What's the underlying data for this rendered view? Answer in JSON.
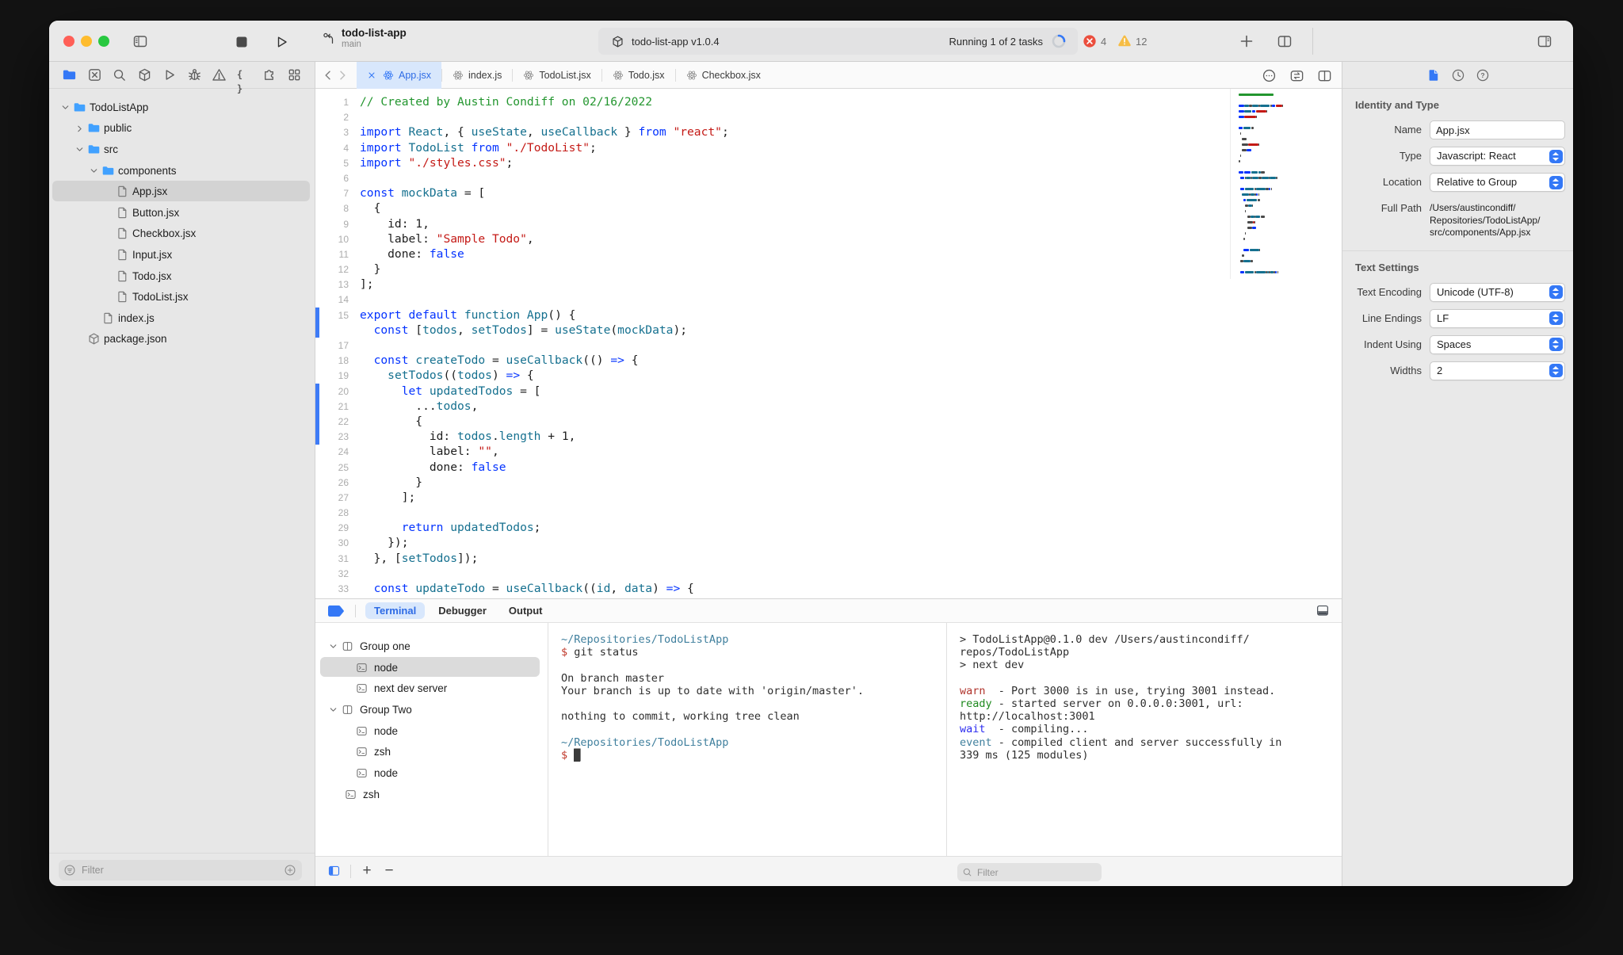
{
  "toolbar": {
    "project": "todo-list-app",
    "branch": "main",
    "status": {
      "package_label": "todo-list-app v1.0.4",
      "tasks_label": "Running 1 of 2 tasks",
      "error_count": "4",
      "warning_count": "12"
    },
    "icons": [
      "sidebar-toggle-icon",
      "stop-icon",
      "run-icon",
      "branch-icon",
      "package-icon",
      "spinner",
      "error-badge-icon",
      "warning-badge-icon",
      "add-icon",
      "split-editor-icon",
      "toggle-inspector-icon"
    ]
  },
  "navigator": {
    "rail_icons": [
      {
        "name": "project-navigator-icon",
        "glyph": "folder",
        "active": true
      },
      {
        "name": "source-control-navigator-icon",
        "glyph": "xsquare"
      },
      {
        "name": "search-navigator-icon",
        "glyph": "search"
      },
      {
        "name": "package-navigator-icon",
        "glyph": "cube"
      },
      {
        "name": "run-navigator-icon",
        "glyph": "play"
      },
      {
        "name": "bug-navigator-icon",
        "glyph": "bug"
      },
      {
        "name": "issues-navigator-icon",
        "glyph": "warn"
      },
      {
        "name": "symbols-navigator-icon",
        "glyph": "braces"
      },
      {
        "name": "extensions-navigator-icon",
        "glyph": "puzzle"
      },
      {
        "name": "overview-navigator-icon",
        "glyph": "grid"
      }
    ],
    "files": [
      {
        "label": "TodoListApp",
        "icon": "folder",
        "level": 0,
        "chevron": "down"
      },
      {
        "label": "public",
        "icon": "folder",
        "level": 1,
        "chevron": "right"
      },
      {
        "label": "src",
        "icon": "folder",
        "level": 1,
        "chevron": "down"
      },
      {
        "label": "components",
        "icon": "folder",
        "level": 2,
        "chevron": "down"
      },
      {
        "label": "App.jsx",
        "icon": "doc",
        "level": 3,
        "selected": true
      },
      {
        "label": "Button.jsx",
        "icon": "doc",
        "level": 3
      },
      {
        "label": "Checkbox.jsx",
        "icon": "doc",
        "level": 3
      },
      {
        "label": "Input.jsx",
        "icon": "doc",
        "level": 3
      },
      {
        "label": "Todo.jsx",
        "icon": "doc",
        "level": 3
      },
      {
        "label": "TodoList.jsx",
        "icon": "doc",
        "level": 3
      },
      {
        "label": "index.js",
        "icon": "doc",
        "level": 2
      },
      {
        "label": "package.json",
        "icon": "cube",
        "level": 1
      }
    ],
    "filter_placeholder": "Filter"
  },
  "editor": {
    "tabs": [
      {
        "label": "App.jsx",
        "active": true
      },
      {
        "label": "index.js"
      },
      {
        "label": "TodoList.jsx"
      },
      {
        "label": "Todo.jsx"
      },
      {
        "label": "Checkbox.jsx"
      }
    ],
    "change_bars": [
      {
        "from": 15,
        "to": 16
      },
      {
        "from": 20,
        "to": 23
      }
    ],
    "lines": [
      {
        "n": "1",
        "t": [
          [
            "// Created by Austin Condiff on 02/16/2022",
            "c"
          ]
        ]
      },
      {
        "n": "2",
        "t": []
      },
      {
        "n": "3",
        "t": [
          [
            "import ",
            "k"
          ],
          [
            "React",
            "i"
          ],
          [
            ", { ",
            "p"
          ],
          [
            "useState",
            "i"
          ],
          [
            ", ",
            "p"
          ],
          [
            "useCallback",
            "i"
          ],
          [
            " } ",
            "p"
          ],
          [
            "from",
            "k"
          ],
          [
            " ",
            "p"
          ],
          [
            "\"react\"",
            "s"
          ],
          [
            ";",
            "p"
          ]
        ]
      },
      {
        "n": "4",
        "t": [
          [
            "import ",
            "k"
          ],
          [
            "TodoList",
            "i"
          ],
          [
            " ",
            "p"
          ],
          [
            "from",
            "k"
          ],
          [
            " ",
            "p"
          ],
          [
            "\"./TodoList\"",
            "s"
          ],
          [
            ";",
            "p"
          ]
        ]
      },
      {
        "n": "5",
        "t": [
          [
            "import ",
            "k"
          ],
          [
            "\"./styles.css\"",
            "s"
          ],
          [
            ";",
            "p"
          ]
        ]
      },
      {
        "n": "6",
        "t": []
      },
      {
        "n": "7",
        "t": [
          [
            "const",
            "k"
          ],
          [
            " ",
            "p"
          ],
          [
            "mockData",
            "i"
          ],
          [
            " = [",
            "p"
          ]
        ]
      },
      {
        "n": "8",
        "t": [
          [
            "  {",
            "p"
          ]
        ]
      },
      {
        "n": "9",
        "t": [
          [
            "    id: 1,",
            "p"
          ]
        ]
      },
      {
        "n": "10",
        "t": [
          [
            "    label: ",
            "p"
          ],
          [
            "\"Sample Todo\"",
            "s"
          ],
          [
            ",",
            "p"
          ]
        ]
      },
      {
        "n": "11",
        "t": [
          [
            "    done: ",
            "p"
          ],
          [
            "false",
            "k"
          ]
        ]
      },
      {
        "n": "12",
        "t": [
          [
            "  }",
            "p"
          ]
        ]
      },
      {
        "n": "13",
        "t": [
          [
            "];",
            "p"
          ]
        ]
      },
      {
        "n": "14",
        "t": []
      },
      {
        "n": "15",
        "t": [
          [
            "export",
            "k"
          ],
          [
            " ",
            "p"
          ],
          [
            "default",
            "k"
          ],
          [
            " ",
            "p"
          ],
          [
            "function",
            "i"
          ],
          [
            " ",
            "p"
          ],
          [
            "App",
            "i"
          ],
          [
            "() {",
            "p"
          ]
        ]
      },
      {
        "n": "",
        "t": [
          [
            "  ",
            "p"
          ],
          [
            "const",
            "k"
          ],
          [
            " [",
            "p"
          ],
          [
            "todos",
            "i"
          ],
          [
            ", ",
            "p"
          ],
          [
            "setTodos",
            "i"
          ],
          [
            "] = ",
            "p"
          ],
          [
            "useState",
            "i"
          ],
          [
            "(",
            "p"
          ],
          [
            "mockData",
            "i"
          ],
          [
            ");",
            "p"
          ]
        ]
      },
      {
        "n": "17",
        "t": []
      },
      {
        "n": "18",
        "t": [
          [
            "  ",
            "p"
          ],
          [
            "const",
            "k"
          ],
          [
            " ",
            "p"
          ],
          [
            "createTodo",
            "i"
          ],
          [
            " = ",
            "p"
          ],
          [
            "useCallback",
            "i"
          ],
          [
            "(() ",
            "p"
          ],
          [
            "=>",
            "k"
          ],
          [
            " {",
            "p"
          ]
        ]
      },
      {
        "n": "19",
        "t": [
          [
            "    ",
            "p"
          ],
          [
            "setTodos",
            "i"
          ],
          [
            "((",
            "p"
          ],
          [
            "todos",
            "i"
          ],
          [
            ") ",
            "p"
          ],
          [
            "=>",
            "k"
          ],
          [
            " {",
            "p"
          ]
        ]
      },
      {
        "n": "20",
        "t": [
          [
            "      ",
            "p"
          ],
          [
            "let",
            "k"
          ],
          [
            " ",
            "p"
          ],
          [
            "updatedTodos",
            "i"
          ],
          [
            " = [",
            "p"
          ]
        ]
      },
      {
        "n": "21",
        "t": [
          [
            "        ...",
            "p"
          ],
          [
            "todos",
            "i"
          ],
          [
            ",",
            "p"
          ]
        ]
      },
      {
        "n": "22",
        "t": [
          [
            "        {",
            "p"
          ]
        ]
      },
      {
        "n": "23",
        "t": [
          [
            "          id: ",
            "p"
          ],
          [
            "todos",
            "i"
          ],
          [
            ".",
            "p"
          ],
          [
            "length",
            "i"
          ],
          [
            " + 1,",
            "p"
          ]
        ]
      },
      {
        "n": "24",
        "t": [
          [
            "          label: ",
            "p"
          ],
          [
            "\"\"",
            "s"
          ],
          [
            ",",
            "p"
          ]
        ]
      },
      {
        "n": "25",
        "t": [
          [
            "          done: ",
            "p"
          ],
          [
            "false",
            "k"
          ]
        ]
      },
      {
        "n": "26",
        "t": [
          [
            "        }",
            "p"
          ]
        ]
      },
      {
        "n": "27",
        "t": [
          [
            "      ];",
            "p"
          ]
        ]
      },
      {
        "n": "28",
        "t": []
      },
      {
        "n": "29",
        "t": [
          [
            "      ",
            "p"
          ],
          [
            "return",
            "k"
          ],
          [
            " ",
            "p"
          ],
          [
            "updatedTodos",
            "i"
          ],
          [
            ";",
            "p"
          ]
        ]
      },
      {
        "n": "30",
        "t": [
          [
            "    });",
            "p"
          ]
        ]
      },
      {
        "n": "31",
        "t": [
          [
            "  }, [",
            "p"
          ],
          [
            "setTodos",
            "i"
          ],
          [
            "]);",
            "p"
          ]
        ]
      },
      {
        "n": "32",
        "t": []
      },
      {
        "n": "33",
        "t": [
          [
            "  ",
            "p"
          ],
          [
            "const",
            "k"
          ],
          [
            " ",
            "p"
          ],
          [
            "updateTodo",
            "i"
          ],
          [
            " = ",
            "p"
          ],
          [
            "useCallback",
            "i"
          ],
          [
            "((",
            "p"
          ],
          [
            "id",
            "i"
          ],
          [
            ", ",
            "p"
          ],
          [
            "data",
            "i"
          ],
          [
            ") ",
            "p"
          ],
          [
            "=>",
            "k"
          ],
          [
            " {",
            "p"
          ]
        ]
      }
    ]
  },
  "inspector": {
    "sections": [
      {
        "title": "Identity and Type",
        "rows": [
          {
            "label": "Name",
            "type": "input",
            "value": "App.jsx"
          },
          {
            "label": "Type",
            "type": "select",
            "value": "Javascript: React"
          },
          {
            "label": "Location",
            "type": "select",
            "value": "Relative to Group"
          },
          {
            "label": "Full Path",
            "type": "text",
            "value": "/Users/austincondiff/\nRepositories/TodoListApp/\nsrc/components/App.jsx"
          }
        ]
      },
      {
        "title": "Text Settings",
        "rows": [
          {
            "label": "Text Encoding",
            "type": "select",
            "value": "Unicode (UTF-8)"
          },
          {
            "label": "Line Endings",
            "type": "select",
            "value": "LF"
          },
          {
            "label": "Indent Using",
            "type": "select",
            "value": "Spaces"
          },
          {
            "label": "Widths",
            "type": "select",
            "value": "2"
          }
        ]
      }
    ]
  },
  "terminal_panel": {
    "tabs": [
      {
        "label": "Terminal",
        "active": true
      },
      {
        "label": "Debugger"
      },
      {
        "label": "Output"
      }
    ],
    "sessions": [
      {
        "label": "Group one",
        "kind": "group",
        "level": 0,
        "chevron": true
      },
      {
        "label": "node",
        "kind": "shell",
        "level": 1,
        "selected": true
      },
      {
        "label": "next dev server",
        "kind": "shell",
        "level": 1
      },
      {
        "label": "Group Two",
        "kind": "group",
        "level": 0,
        "chevron": true
      },
      {
        "label": "node",
        "kind": "shell",
        "level": 1
      },
      {
        "label": "zsh",
        "kind": "shell",
        "level": 1
      },
      {
        "label": "node",
        "kind": "shell",
        "level": 1
      },
      {
        "label": "zsh",
        "kind": "shell",
        "level": 0
      }
    ],
    "shell_left": [
      [
        [
          "~/Repositories/TodoListApp",
          "path"
        ]
      ],
      [
        [
          "$",
          "prompt"
        ],
        [
          " git status",
          "plain"
        ]
      ],
      [],
      [
        [
          "On branch master",
          "plain"
        ]
      ],
      [
        [
          "Your branch is up to date with 'origin/master'.",
          "plain"
        ]
      ],
      [],
      [
        [
          "nothing to commit, working tree clean",
          "plain"
        ]
      ],
      [],
      [
        [
          "~/Repositories/TodoListApp",
          "path"
        ]
      ],
      [
        [
          "$ ",
          "prompt"
        ],
        [
          "█",
          "cursor"
        ]
      ]
    ],
    "shell_right": [
      [
        [
          "> TodoListApp@0.1.0 dev /Users/austincondiff/",
          "plain"
        ]
      ],
      [
        [
          "repos/TodoListApp",
          "plain"
        ]
      ],
      [
        [
          "> next dev",
          "plain"
        ]
      ],
      [],
      [
        [
          "warn",
          "warn"
        ],
        [
          "  - Port 3000 is in use, trying 3001 instead.",
          "plain"
        ]
      ],
      [
        [
          "ready",
          "ready"
        ],
        [
          " - started server on 0.0.0.0:3001, url:",
          "plain"
        ]
      ],
      [
        [
          "http://localhost:3001",
          "plain"
        ]
      ],
      [
        [
          "wait",
          "wait"
        ],
        [
          "  - compiling...",
          "plain"
        ]
      ],
      [
        [
          "event",
          "event"
        ],
        [
          " - compiled client and server successfully in",
          "plain"
        ]
      ],
      [
        [
          "339 ms (125 modules)",
          "plain"
        ]
      ]
    ],
    "filter_placeholder": "Filter"
  },
  "colors": {
    "accent": "#3478F6",
    "error": "#EB4E3D",
    "warning": "#F6BD45",
    "syntax_keyword": "#0433FF",
    "syntax_type": "#15708F",
    "syntax_string": "#C41A16",
    "syntax_comment": "#23962F",
    "traffic_red": "#FF5F57",
    "traffic_yellow": "#FEBC2E",
    "traffic_green": "#28C840"
  }
}
